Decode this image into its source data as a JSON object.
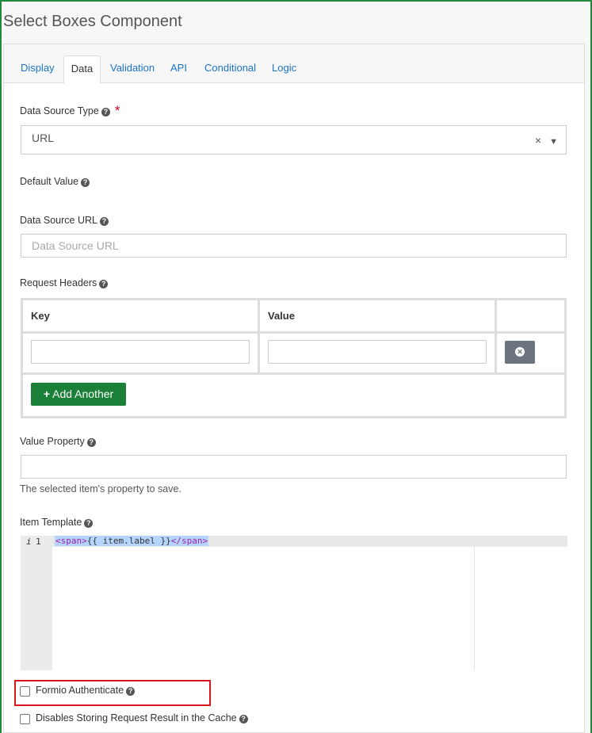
{
  "header": {
    "title": "Select Boxes Component"
  },
  "tabs": [
    {
      "label": "Display"
    },
    {
      "label": "Data"
    },
    {
      "label": "Validation"
    },
    {
      "label": "API"
    },
    {
      "label": "Conditional"
    },
    {
      "label": "Logic"
    }
  ],
  "data_source_type": {
    "label": "Data Source Type",
    "value": "URL",
    "required_mark": "*"
  },
  "default_value": {
    "label": "Default Value"
  },
  "data_source_url": {
    "label": "Data Source URL",
    "placeholder": "Data Source URL"
  },
  "request_headers": {
    "label": "Request Headers",
    "columns": [
      "Key",
      "Value"
    ],
    "add_label": "Add Another"
  },
  "value_property": {
    "label": "Value Property",
    "help": "The selected item's property to save."
  },
  "item_template": {
    "label": "Item Template",
    "line_number": "1",
    "gutter_icon": "i",
    "code_open": "<span>",
    "code_body": "{{ item.label }}",
    "code_close": "</span>"
  },
  "checkboxes": [
    {
      "label": "Formio Authenticate",
      "checked": false
    },
    {
      "label": "Disables Storing Request Result in the Cache",
      "checked": false
    }
  ],
  "colors": {
    "accent": "#1a73c8",
    "success": "#1a7f37",
    "highlight_border": "#d9161f"
  },
  "icons": {
    "help": "question-circle-icon",
    "clear": "clear-x-icon",
    "caret": "caret-down-icon",
    "plus": "plus-icon",
    "remove": "remove-circle-icon"
  }
}
